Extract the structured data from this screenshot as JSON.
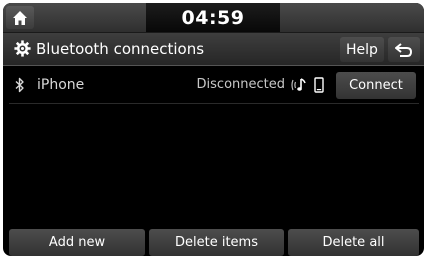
{
  "status_bar": {
    "clock": "04:59",
    "home_icon": "home-icon"
  },
  "header": {
    "title": "Bluetooth connections",
    "title_icon": "gear-icon",
    "help_label": "Help",
    "back_icon": "back-arrow-icon"
  },
  "devices": [
    {
      "name": "iPhone",
      "status": "Disconnected",
      "icons": [
        "bluetooth-icon",
        "audio-streaming-icon",
        "phone-icon"
      ],
      "action_label": "Connect"
    }
  ],
  "footer": {
    "add_new_label": "Add new",
    "delete_items_label": "Delete items",
    "delete_all_label": "Delete all"
  },
  "colors": {
    "background": "#000000",
    "button": "#404040",
    "text": "#ffffff"
  }
}
